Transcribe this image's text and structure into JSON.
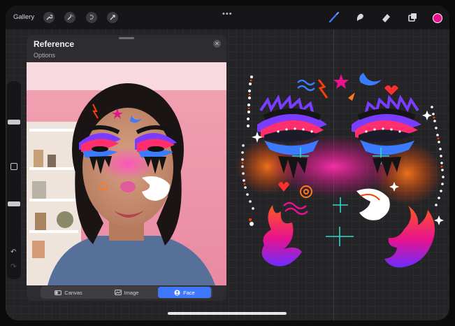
{
  "topbar": {
    "gallery_label": "Gallery",
    "left_tools": [
      "wrench-icon",
      "magic-wand-icon",
      "selection-icon",
      "transform-arrow-icon"
    ],
    "more_icon": "ellipsis-icon",
    "right_tools": [
      "brush-icon",
      "smudge-icon",
      "eraser-icon",
      "layers-icon"
    ],
    "current_color": "#e8128f"
  },
  "sidebar": {
    "top_slider_label": "brush-size",
    "bottom_slider_label": "opacity",
    "undo_icon": "undo-icon",
    "redo_icon": "redo-icon"
  },
  "reference": {
    "title": "Reference",
    "options_label": "Options",
    "close_icon": "close-icon",
    "tabs": [
      {
        "label": "Canvas",
        "icon": "canvas-icon",
        "active": false
      },
      {
        "label": "Image",
        "icon": "image-icon",
        "active": false
      },
      {
        "label": "Face",
        "icon": "face-icon",
        "active": true
      }
    ]
  },
  "colors": {
    "accent_blue": "#3f78ff",
    "magenta": "#e8128f",
    "orange": "#ff5a1f",
    "purple": "#7a3cff"
  }
}
